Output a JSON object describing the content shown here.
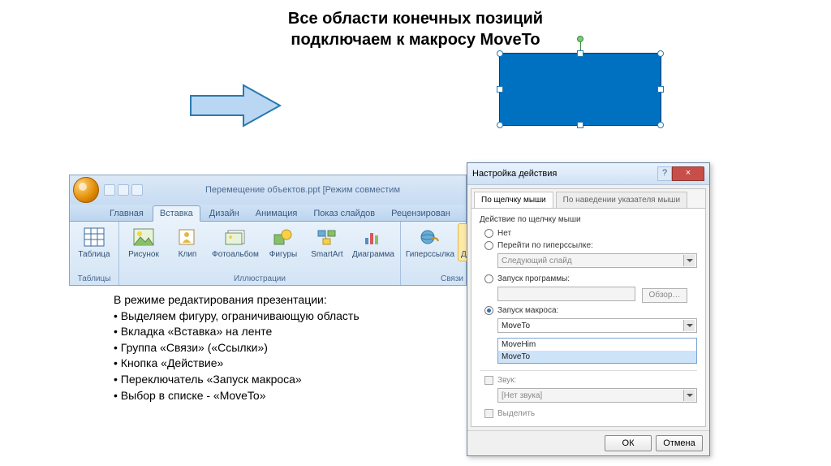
{
  "title_line1": "Все области конечных позиций",
  "title_line2": "подключаем к макросу MoveTo",
  "instructions": {
    "intro": "В режиме редактирования презентации:",
    "items": [
      "Выделяем фигуру, ограничивающую область",
      "Вкладка «Вставка» на ленте",
      "Группа «Связи» («Ссылки»)",
      "Кнопка «Действие»",
      "Переключатель «Запуск макроса»",
      "Выбор в списке - «MoveTo»"
    ]
  },
  "ribbon": {
    "doc_title": "Перемещение объектов.ppt [Режим совместим",
    "tabs": [
      "Главная",
      "Вставка",
      "Дизайн",
      "Анимация",
      "Показ слайдов",
      "Рецензирован"
    ],
    "groups": {
      "tables": {
        "label": "Таблицы",
        "items": [
          {
            "label": "Таблица",
            "icon": "table-icon"
          }
        ]
      },
      "illustrations": {
        "label": "Иллюстрации",
        "items": [
          {
            "label": "Рисунок",
            "icon": "picture-icon"
          },
          {
            "label": "Клип",
            "icon": "clip-icon"
          },
          {
            "label": "Фотоальбом",
            "icon": "album-icon"
          },
          {
            "label": "Фигуры",
            "icon": "shapes-icon"
          },
          {
            "label": "SmartArt",
            "icon": "smartart-icon"
          },
          {
            "label": "Диаграмма",
            "icon": "chart-icon"
          }
        ]
      },
      "links": {
        "label": "Связи",
        "items": [
          {
            "label": "Гиперссылка",
            "icon": "hyperlink-icon"
          },
          {
            "label": "Действие",
            "icon": "action-icon",
            "selected": true
          }
        ]
      }
    }
  },
  "dialog": {
    "title": "Настройка действия",
    "tabs": [
      "По щелчку мыши",
      "По наведении указателя мыши"
    ],
    "group_label": "Действие по щелчку мыши",
    "none_label": "Нет",
    "hyperlink_label": "Перейти по гиперссылке:",
    "hyperlink_value": "Следующий слайд",
    "program_label": "Запуск программы:",
    "browse_label": "Обзор…",
    "macro_label": "Запуск макроса:",
    "macro_value": "MoveTo",
    "macro_options": [
      "MoveHim",
      "MoveTo"
    ],
    "sound_label": "Звук:",
    "sound_value": "[Нет звука]",
    "highlight_label": "Выделить",
    "ok": "ОК",
    "cancel": "Отмена"
  }
}
